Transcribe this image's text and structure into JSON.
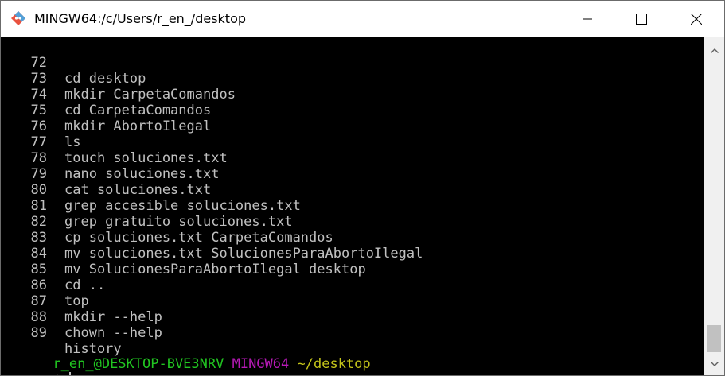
{
  "window": {
    "title": "MINGW64:/c/Users/r_en_/desktop",
    "icon": "git-bash-icon",
    "controls": {
      "minimize": "minimize-icon",
      "maximize": "maximize-icon",
      "close": "close-icon"
    }
  },
  "history": [
    {
      "num": "72",
      "cmd": "cd desktop"
    },
    {
      "num": "73",
      "cmd": "mkdir CarpetaComandos"
    },
    {
      "num": "74",
      "cmd": "cd CarpetaComandos"
    },
    {
      "num": "75",
      "cmd": "mkdir AbortoIlegal"
    },
    {
      "num": "76",
      "cmd": "ls"
    },
    {
      "num": "77",
      "cmd": "touch soluciones.txt"
    },
    {
      "num": "78",
      "cmd": "nano soluciones.txt"
    },
    {
      "num": "79",
      "cmd": "cat soluciones.txt"
    },
    {
      "num": "80",
      "cmd": "grep accesible soluciones.txt"
    },
    {
      "num": "81",
      "cmd": "grep gratuito soluciones.txt"
    },
    {
      "num": "82",
      "cmd": "cp soluciones.txt CarpetaComandos"
    },
    {
      "num": "83",
      "cmd": "mv soluciones.txt SolucionesParaAbortoIlegal"
    },
    {
      "num": "84",
      "cmd": "mv SolucionesParaAbortoIlegal desktop"
    },
    {
      "num": "85",
      "cmd": "cd .."
    },
    {
      "num": "86",
      "cmd": "top"
    },
    {
      "num": "87",
      "cmd": "mkdir --help"
    },
    {
      "num": "88",
      "cmd": "chown --help"
    },
    {
      "num": "89",
      "cmd": "history"
    }
  ],
  "prompt": {
    "user_host": "r_en_@DESKTOP-BVE3NRV",
    "system": "MINGW64",
    "path": "~/desktop",
    "symbol": "$"
  },
  "colors": {
    "background": "#000000",
    "text": "#c0c0c0",
    "user_host": "#21c521",
    "system": "#b81ab8",
    "path": "#c4c41a"
  }
}
